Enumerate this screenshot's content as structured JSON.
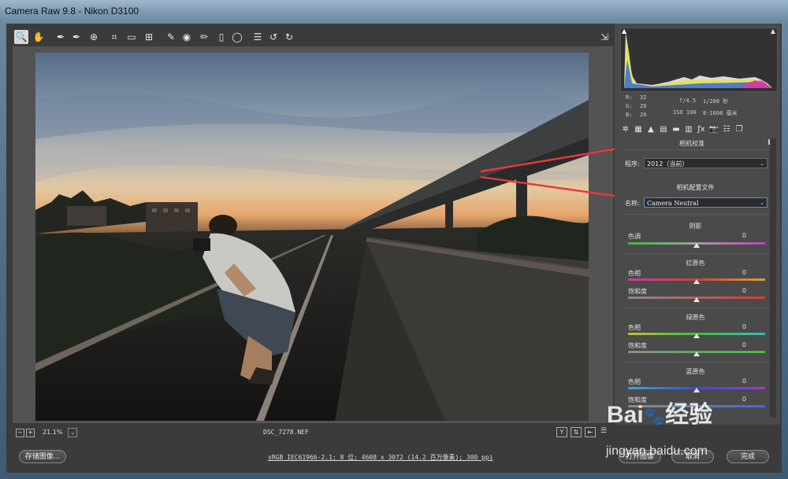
{
  "window": {
    "title": "Camera Raw 9.8  -  Nikon D3100"
  },
  "toolbar": {
    "tools": [
      {
        "name": "zoom-tool-icon",
        "glyph": "🔍"
      },
      {
        "name": "hand-tool-icon",
        "glyph": "✋"
      },
      {
        "name": "white-balance-tool-icon",
        "glyph": "✒"
      },
      {
        "name": "color-sampler-tool-icon",
        "glyph": "✒"
      },
      {
        "name": "targeted-adjustment-tool-icon",
        "glyph": "⊕"
      },
      {
        "name": "crop-tool-icon",
        "glyph": "⌗"
      },
      {
        "name": "straighten-tool-icon",
        "glyph": "▭"
      },
      {
        "name": "transform-tool-icon",
        "glyph": "⊞"
      },
      {
        "name": "spot-removal-tool-icon",
        "glyph": "✎"
      },
      {
        "name": "red-eye-tool-icon",
        "glyph": "◉"
      },
      {
        "name": "adjustment-brush-icon",
        "glyph": "✏"
      },
      {
        "name": "graduated-filter-icon",
        "glyph": "▯"
      },
      {
        "name": "radial-filter-icon",
        "glyph": "◯"
      },
      {
        "name": "preferences-icon",
        "glyph": "☰"
      },
      {
        "name": "rotate-left-icon",
        "glyph": "↺"
      },
      {
        "name": "rotate-right-icon",
        "glyph": "↻"
      }
    ],
    "fullscreen_icon": "⇲"
  },
  "histogram": {
    "rgb": {
      "r_label": "R:",
      "r": "32",
      "g_label": "G:",
      "g": "26",
      "b_label": "B:",
      "b": "20"
    },
    "exif": {
      "aperture": "f/4.5",
      "shutter": "1/200 秒",
      "iso": "ISO 100",
      "focal": "8-1608 毫米"
    }
  },
  "panel_tabs": [
    {
      "name": "basic-tab-icon",
      "glyph": "✲"
    },
    {
      "name": "tone-curve-tab-icon",
      "glyph": "▦"
    },
    {
      "name": "detail-tab-icon",
      "glyph": "▲"
    },
    {
      "name": "hsl-tab-icon",
      "glyph": "▤"
    },
    {
      "name": "split-toning-tab-icon",
      "glyph": "▬"
    },
    {
      "name": "lens-corrections-tab-icon",
      "glyph": "▥"
    },
    {
      "name": "effects-tab-icon",
      "glyph": "ƒx"
    },
    {
      "name": "camera-calibration-tab-icon",
      "glyph": "📷"
    },
    {
      "name": "presets-tab-icon",
      "glyph": "☷"
    },
    {
      "name": "snapshots-tab-icon",
      "glyph": "❐"
    }
  ],
  "calibration": {
    "panel_title": "相机校准",
    "process_label": "程序:",
    "process_value": "2012（当前）",
    "profile_title": "相机配置文件",
    "name_label": "名称:",
    "name_value": "Camera Neutral",
    "shadows": {
      "title": "阴影",
      "tint_label": "色调",
      "tint_value": "0"
    },
    "red": {
      "title": "红原色",
      "hue_label": "色相",
      "hue_value": "0",
      "sat_label": "饱和度",
      "sat_value": "0"
    },
    "green": {
      "title": "绿原色",
      "hue_label": "色相",
      "hue_value": "0",
      "sat_label": "饱和度",
      "sat_value": "0"
    },
    "blue": {
      "title": "蓝原色",
      "hue_label": "色相",
      "hue_value": "0",
      "sat_label": "饱和度",
      "sat_value": "0"
    }
  },
  "status": {
    "zoom_value": "21.1%",
    "filename": "DSC_7278.NEF",
    "workflow_link": "sRGB IEC61966-2.1; 8 位; 4608 x 3072 (14.2 百万像素); 300 ppi"
  },
  "footer": {
    "save_label": "存储图像...",
    "open_label": "打开图像",
    "cancel_label": "取消",
    "done_label": "完成"
  },
  "watermark": {
    "brand": "Bai",
    "brand2": "经验",
    "url": "jingyan.baidu.com"
  },
  "colors": {
    "accent_arrow": "#e8383a",
    "window_bg": "#3b3b3b",
    "panel_bg": "#4a4a4a"
  }
}
